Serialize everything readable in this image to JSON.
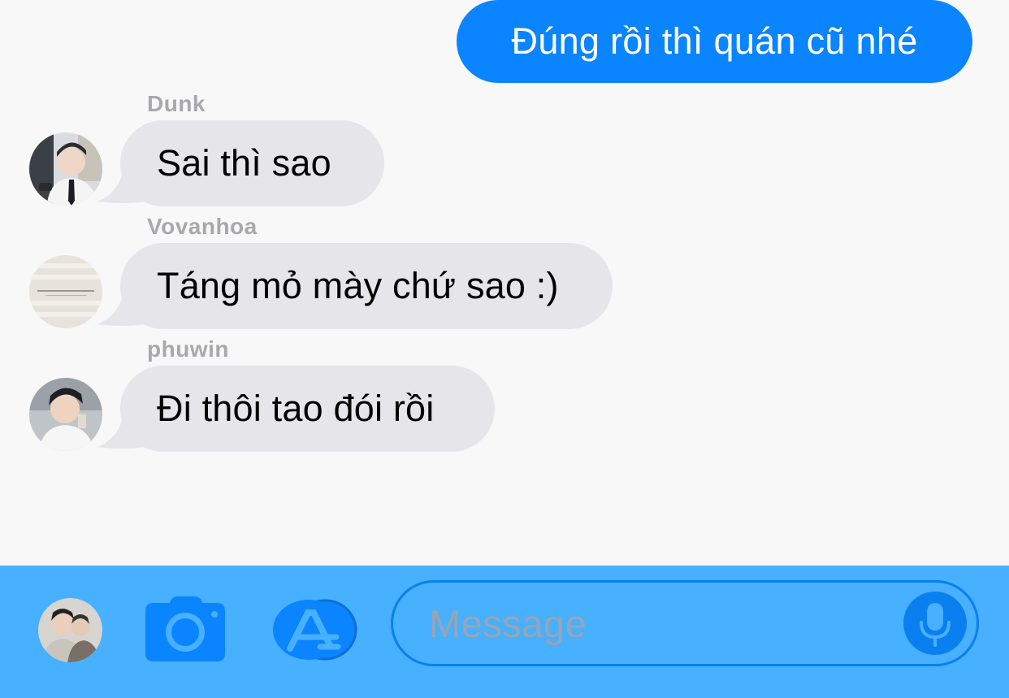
{
  "outgoing": {
    "text": "Đúng rồi thì quán cũ nhé",
    "color": "#0a84ff"
  },
  "messages": [
    {
      "sender": "Dunk",
      "text": "Sai thì sao",
      "avatar_icon": "user-avatar-photo"
    },
    {
      "sender": "Vovanhoa",
      "text": "Táng mỏ mày chứ sao :)",
      "avatar_icon": "user-avatar-photo"
    },
    {
      "sender": "phuwin",
      "text": "Đi thôi tao đói rồi",
      "avatar_icon": "user-avatar-photo"
    }
  ],
  "input_bar": {
    "placeholder": "Message",
    "background": "#47b0ff",
    "icons": [
      "profile-avatar",
      "camera-icon",
      "app-store-icon",
      "microphone-icon"
    ]
  }
}
